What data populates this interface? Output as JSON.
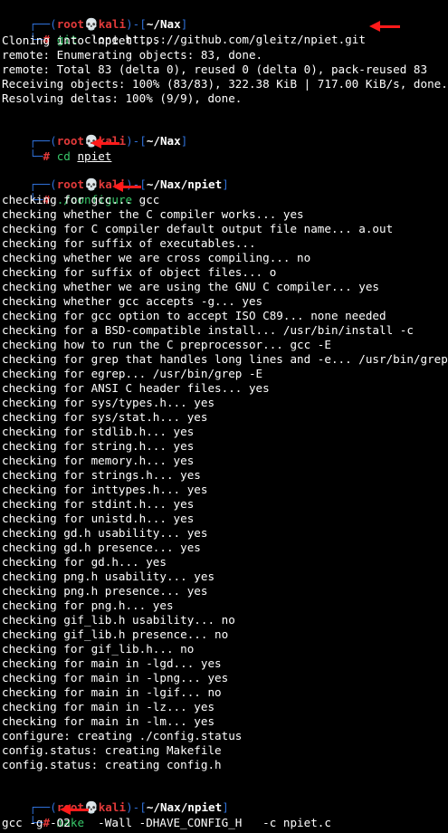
{
  "prompts": [
    {
      "user": "root",
      "skull": "💀",
      "host": "kali",
      "path": "~/Nax",
      "corner_top": "┌──(",
      "sep": ")-[",
      "close": "]",
      "corner_bottom": "└─",
      "hash": "#",
      "command": "git",
      "args": "clone https://github.com/gleitz/npiet.git"
    },
    {
      "user": "root",
      "skull": "💀",
      "host": "kali",
      "path": "~/Nax",
      "corner_top": "┌──(",
      "sep": ")-[",
      "close": "]",
      "corner_bottom": "└─",
      "hash": "#",
      "command": "cd",
      "args": "npiet"
    },
    {
      "user": "root",
      "skull": "💀",
      "host": "kali",
      "path": "~/Nax/npiet",
      "corner_top": "┌──(",
      "sep": ")-[",
      "close": "]",
      "corner_bottom": "└─",
      "hash": "#",
      "command": "./configure",
      "args": ""
    },
    {
      "user": "root",
      "skull": "💀",
      "host": "kali",
      "path": "~/Nax/npiet",
      "corner_top": "┌──(",
      "sep": ")-[",
      "close": "]",
      "corner_bottom": "└─",
      "hash": "#",
      "command": "make",
      "args": ""
    }
  ],
  "clone_output": [
    "Cloning into 'npiet'...",
    "remote: Enumerating objects: 83, done.",
    "remote: Total 83 (delta 0), reused 0 (delta 0), pack-reused 83",
    "Receiving objects: 100% (83/83), 322.38 KiB | 717.00 KiB/s, done.",
    "Resolving deltas: 100% (9/9), done."
  ],
  "configure_output": [
    "checking for gcc... gcc",
    "checking whether the C compiler works... yes",
    "checking for C compiler default output file name... a.out",
    "checking for suffix of executables...",
    "checking whether we are cross compiling... no",
    "checking for suffix of object files... o",
    "checking whether we are using the GNU C compiler... yes",
    "checking whether gcc accepts -g... yes",
    "checking for gcc option to accept ISO C89... none needed",
    "checking for a BSD-compatible install... /usr/bin/install -c",
    "checking how to run the C preprocessor... gcc -E",
    "checking for grep that handles long lines and -e... /usr/bin/grep",
    "checking for egrep... /usr/bin/grep -E",
    "checking for ANSI C header files... yes",
    "checking for sys/types.h... yes",
    "checking for sys/stat.h... yes",
    "checking for stdlib.h... yes",
    "checking for string.h... yes",
    "checking for memory.h... yes",
    "checking for strings.h... yes",
    "checking for inttypes.h... yes",
    "checking for stdint.h... yes",
    "checking for unistd.h... yes",
    "checking gd.h usability... yes",
    "checking gd.h presence... yes",
    "checking for gd.h... yes",
    "checking png.h usability... yes",
    "checking png.h presence... yes",
    "checking for png.h... yes",
    "checking gif_lib.h usability... no",
    "checking gif_lib.h presence... no",
    "checking for gif_lib.h... no",
    "checking for main in -lgd... yes",
    "checking for main in -lpng... yes",
    "checking for main in -lgif... no",
    "checking for main in -lz... yes",
    "checking for main in -lm... yes",
    "configure: creating ./config.status",
    "config.status: creating Makefile",
    "config.status: creating config.h"
  ],
  "make_output": [
    "gcc -g -O2    -Wall -DHAVE_CONFIG_H   -c npiet.c"
  ],
  "colors": {
    "background": "#000000",
    "text": "#ffffff",
    "bracket_blue": "#2f6fd6",
    "prompt_red": "#e23a3a",
    "command_green": "#38c96a",
    "annotation_arrow": "#ff1a1a"
  }
}
